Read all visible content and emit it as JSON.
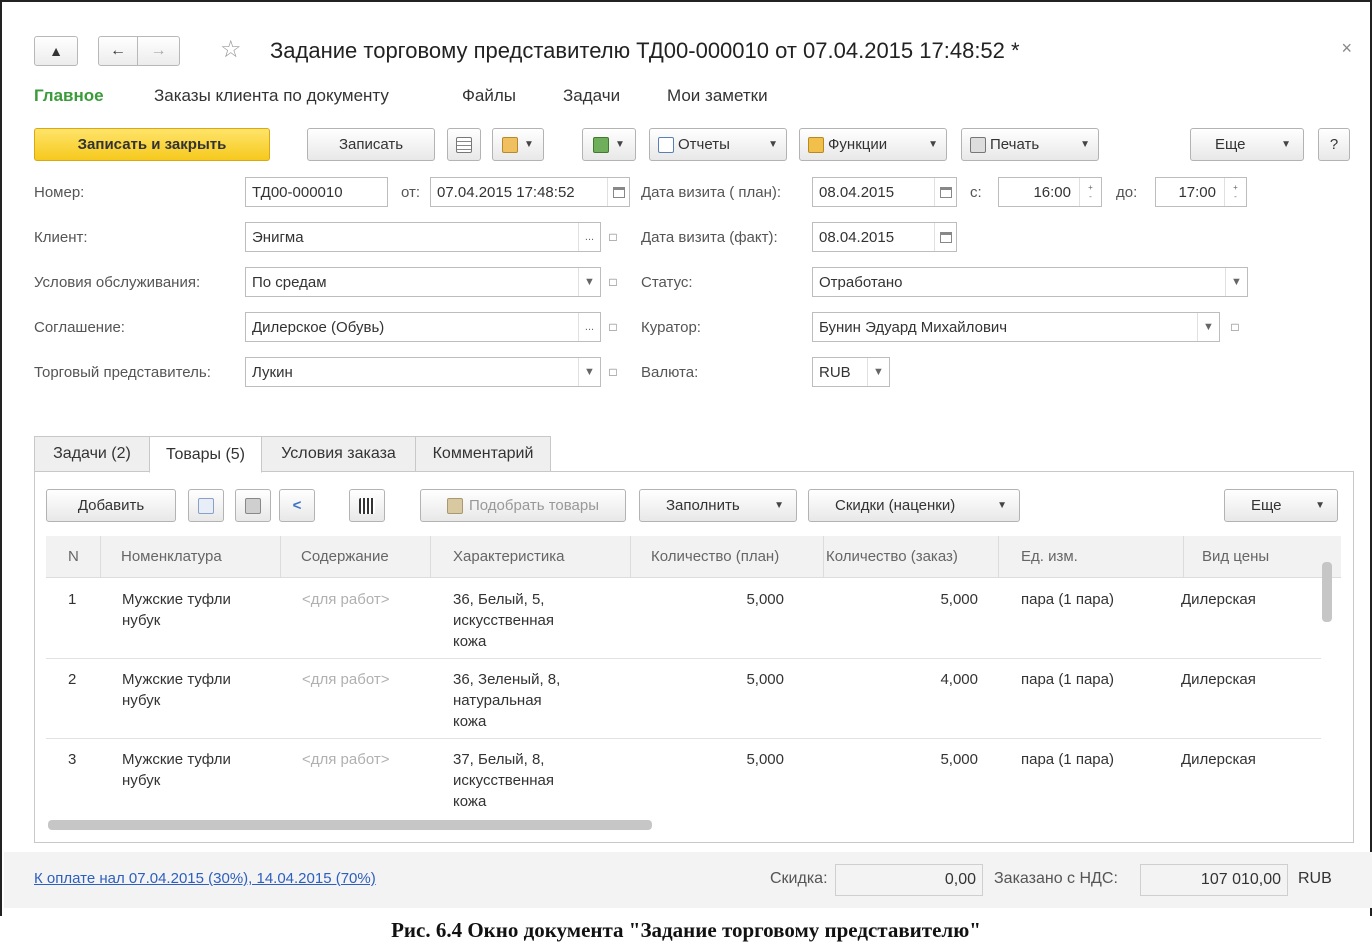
{
  "window": {
    "title": "Задание торговому представителю ТД00-000010 от 07.04.2015 17:48:52 *",
    "close_icon": "×"
  },
  "nav_tabs": [
    "Главное",
    "Заказы клиента по документу",
    "Файлы",
    "Задачи",
    "Мои заметки"
  ],
  "toolbar": {
    "save_close": "Записать и закрыть",
    "save": "Записать",
    "reports": "Отчеты",
    "functions": "Функции",
    "print": "Печать",
    "more": "Еще",
    "help": "?"
  },
  "form": {
    "number_label": "Номер:",
    "number": "ТД00-000010",
    "from_label": "от:",
    "date": "07.04.2015 17:48:52",
    "visit_plan_label": "Дата визита ( план):",
    "visit_plan": "08.04.2015",
    "from_time_label": "с:",
    "from_time": "16:00",
    "to_time_label": "до:",
    "to_time": "17:00",
    "client_label": "Клиент:",
    "client": "Энигма",
    "visit_fact_label": "Дата визита (факт):",
    "visit_fact": "08.04.2015",
    "service_label": "Условия обслуживания:",
    "service": "По средам",
    "status_label": "Статус:",
    "status": "Отработано",
    "agreement_label": "Соглашение:",
    "agreement": "Дилерское (Обувь)",
    "curator_label": "Куратор:",
    "curator": "Бунин Эдуард Михайлович",
    "rep_label": "Торговый представитель:",
    "rep": "Лукин",
    "currency_label": "Валюта:",
    "currency": "RUB"
  },
  "tabs": [
    "Задачи (2)",
    "Товары (5)",
    "Условия заказа",
    "Комментарий"
  ],
  "table_toolbar": {
    "add": "Добавить",
    "pick": "Подобрать товары",
    "fill": "Заполнить",
    "discounts": "Скидки (наценки)",
    "more": "Еще"
  },
  "table": {
    "columns": [
      "N",
      "Номенклатура",
      "Содержание",
      "Характеристика",
      "Количество (план)",
      "Количество (заказ)",
      "Ед. изм.",
      "Вид цены"
    ],
    "rows": [
      {
        "n": "1",
        "name1": "Мужские туфли",
        "name2": "нубук",
        "content": "<для работ>",
        "ch1": "36, Белый, 5,",
        "ch2": "искусственная",
        "ch3": "кожа",
        "qplan": "5,000",
        "qorder": "5,000",
        "unit": "пара (1 пара)",
        "price": "Дилерская"
      },
      {
        "n": "2",
        "name1": "Мужские туфли",
        "name2": "нубук",
        "content": "<для работ>",
        "ch1": "36, Зеленый, 8,",
        "ch2": "натуральная",
        "ch3": "кожа",
        "qplan": "5,000",
        "qorder": "4,000",
        "unit": "пара (1 пара)",
        "price": "Дилерская"
      },
      {
        "n": "3",
        "name1": "Мужские туфли",
        "name2": "нубук",
        "content": "<для работ>",
        "ch1": "37, Белый, 8,",
        "ch2": "искусственная",
        "ch3": "кожа",
        "qplan": "5,000",
        "qorder": "5,000",
        "unit": "пара (1 пара)",
        "price": "Дилерская"
      }
    ]
  },
  "footer": {
    "payment_link": "К оплате нал 07.04.2015 (30%), 14.04.2015 (70%)",
    "discount_label": "Скидка:",
    "discount": "0,00",
    "ordered_label": "Заказано с НДС:",
    "ordered": "107 010,00",
    "currency": "RUB"
  },
  "caption": "Рис. 6.4 Окно документа \"Задание торговому представителю\"",
  "colors": {
    "primary": "#f6c91d",
    "active_tab": "#3a9b3a",
    "link": "#2d5fbf"
  }
}
